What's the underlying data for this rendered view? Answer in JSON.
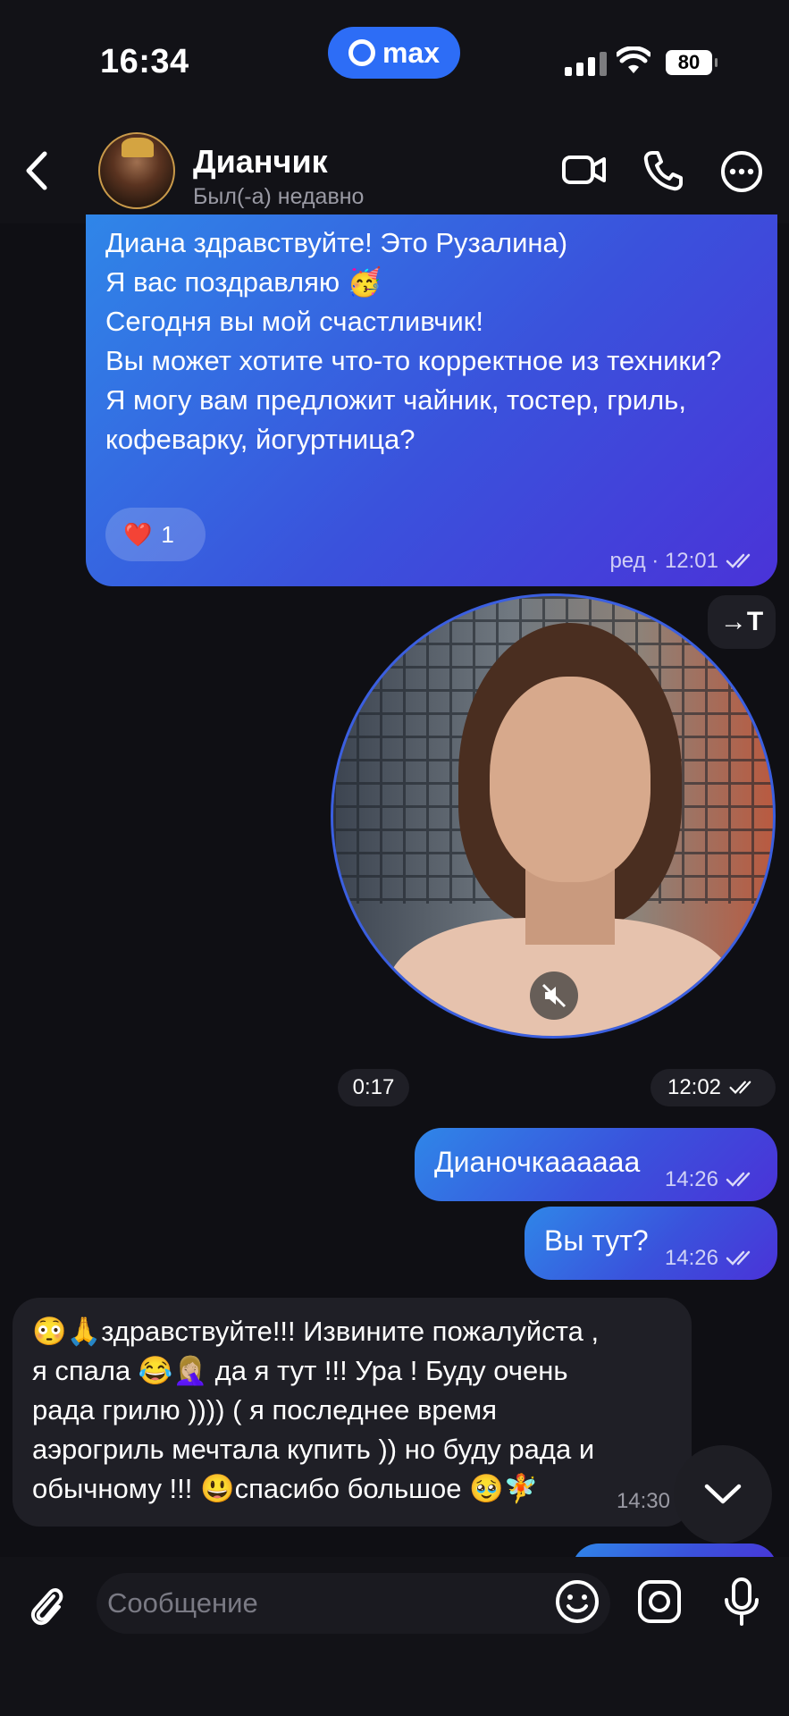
{
  "status_bar": {
    "time": "16:34",
    "app_badge": "max",
    "battery": "80"
  },
  "header": {
    "contact_name": "Дианчик",
    "contact_status": "Был(-а) недавно"
  },
  "messages": [
    {
      "direction": "outgoing",
      "text": "Диана здравствуйте! Это Рузалина)\nЯ вас поздравляю 🥳\nСегодня вы мой счастливчик!\nВы может хотите что-то корректное из техники?\nЯ могу вам предложит чайник, тостер, гриль, кофеварку, йогуртница?",
      "reaction_emoji": "❤️",
      "reaction_count": "1",
      "meta": "ред · 12:01"
    },
    {
      "direction": "outgoing",
      "type": "video_note",
      "duration": "0:17",
      "time": "12:02"
    },
    {
      "direction": "outgoing",
      "text": "Дианочкаааааа",
      "time": "14:26"
    },
    {
      "direction": "outgoing",
      "text": "Вы тут?",
      "time": "14:26"
    },
    {
      "direction": "incoming",
      "text": "😳🙏здравствуйте!!! Извините пожалуйста ,\nя спала 😂🤦🏼‍♀️ да я тут !!! Ура ! Буду очень\nрада грилю )))) ( я последнее время\nаэрогриль мечтала купить )) но буду рада и\nобычному !!! 😃спасибо большое 🥹🧚",
      "time": "14:30"
    }
  ],
  "input": {
    "placeholder": "Сообщение"
  },
  "colors": {
    "accent": "#2d6df6",
    "bubble_out_start": "#2f86e8",
    "bubble_out_end": "#4a33d8",
    "bubble_in": "#1f1f26",
    "background": "#0f0f14"
  },
  "icons": [
    "back-icon",
    "video-call-icon",
    "phone-icon",
    "more-icon",
    "speaker-off-icon",
    "transcribe-icon",
    "chevron-down-icon",
    "attach-icon",
    "emoji-icon",
    "camera-icon",
    "mic-icon"
  ]
}
